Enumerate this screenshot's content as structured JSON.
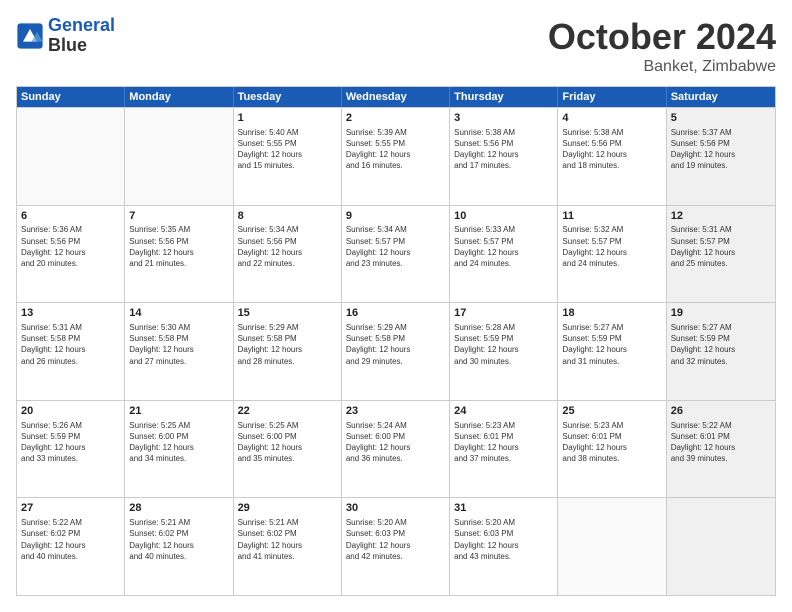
{
  "header": {
    "logo_line1": "General",
    "logo_line2": "Blue",
    "month": "October 2024",
    "location": "Banket, Zimbabwe"
  },
  "weekdays": [
    "Sunday",
    "Monday",
    "Tuesday",
    "Wednesday",
    "Thursday",
    "Friday",
    "Saturday"
  ],
  "rows": [
    [
      {
        "day": "",
        "empty": true
      },
      {
        "day": "",
        "empty": true
      },
      {
        "day": "1",
        "lines": [
          "Sunrise: 5:40 AM",
          "Sunset: 5:55 PM",
          "Daylight: 12 hours",
          "and 15 minutes."
        ]
      },
      {
        "day": "2",
        "lines": [
          "Sunrise: 5:39 AM",
          "Sunset: 5:55 PM",
          "Daylight: 12 hours",
          "and 16 minutes."
        ]
      },
      {
        "day": "3",
        "lines": [
          "Sunrise: 5:38 AM",
          "Sunset: 5:56 PM",
          "Daylight: 12 hours",
          "and 17 minutes."
        ]
      },
      {
        "day": "4",
        "lines": [
          "Sunrise: 5:38 AM",
          "Sunset: 5:56 PM",
          "Daylight: 12 hours",
          "and 18 minutes."
        ]
      },
      {
        "day": "5",
        "lines": [
          "Sunrise: 5:37 AM",
          "Sunset: 5:56 PM",
          "Daylight: 12 hours",
          "and 19 minutes."
        ],
        "shaded": true
      }
    ],
    [
      {
        "day": "6",
        "lines": [
          "Sunrise: 5:36 AM",
          "Sunset: 5:56 PM",
          "Daylight: 12 hours",
          "and 20 minutes."
        ]
      },
      {
        "day": "7",
        "lines": [
          "Sunrise: 5:35 AM",
          "Sunset: 5:56 PM",
          "Daylight: 12 hours",
          "and 21 minutes."
        ]
      },
      {
        "day": "8",
        "lines": [
          "Sunrise: 5:34 AM",
          "Sunset: 5:56 PM",
          "Daylight: 12 hours",
          "and 22 minutes."
        ]
      },
      {
        "day": "9",
        "lines": [
          "Sunrise: 5:34 AM",
          "Sunset: 5:57 PM",
          "Daylight: 12 hours",
          "and 23 minutes."
        ]
      },
      {
        "day": "10",
        "lines": [
          "Sunrise: 5:33 AM",
          "Sunset: 5:57 PM",
          "Daylight: 12 hours",
          "and 24 minutes."
        ]
      },
      {
        "day": "11",
        "lines": [
          "Sunrise: 5:32 AM",
          "Sunset: 5:57 PM",
          "Daylight: 12 hours",
          "and 24 minutes."
        ]
      },
      {
        "day": "12",
        "lines": [
          "Sunrise: 5:31 AM",
          "Sunset: 5:57 PM",
          "Daylight: 12 hours",
          "and 25 minutes."
        ],
        "shaded": true
      }
    ],
    [
      {
        "day": "13",
        "lines": [
          "Sunrise: 5:31 AM",
          "Sunset: 5:58 PM",
          "Daylight: 12 hours",
          "and 26 minutes."
        ]
      },
      {
        "day": "14",
        "lines": [
          "Sunrise: 5:30 AM",
          "Sunset: 5:58 PM",
          "Daylight: 12 hours",
          "and 27 minutes."
        ]
      },
      {
        "day": "15",
        "lines": [
          "Sunrise: 5:29 AM",
          "Sunset: 5:58 PM",
          "Daylight: 12 hours",
          "and 28 minutes."
        ]
      },
      {
        "day": "16",
        "lines": [
          "Sunrise: 5:29 AM",
          "Sunset: 5:58 PM",
          "Daylight: 12 hours",
          "and 29 minutes."
        ]
      },
      {
        "day": "17",
        "lines": [
          "Sunrise: 5:28 AM",
          "Sunset: 5:59 PM",
          "Daylight: 12 hours",
          "and 30 minutes."
        ]
      },
      {
        "day": "18",
        "lines": [
          "Sunrise: 5:27 AM",
          "Sunset: 5:59 PM",
          "Daylight: 12 hours",
          "and 31 minutes."
        ]
      },
      {
        "day": "19",
        "lines": [
          "Sunrise: 5:27 AM",
          "Sunset: 5:59 PM",
          "Daylight: 12 hours",
          "and 32 minutes."
        ],
        "shaded": true
      }
    ],
    [
      {
        "day": "20",
        "lines": [
          "Sunrise: 5:26 AM",
          "Sunset: 5:59 PM",
          "Daylight: 12 hours",
          "and 33 minutes."
        ]
      },
      {
        "day": "21",
        "lines": [
          "Sunrise: 5:25 AM",
          "Sunset: 6:00 PM",
          "Daylight: 12 hours",
          "and 34 minutes."
        ]
      },
      {
        "day": "22",
        "lines": [
          "Sunrise: 5:25 AM",
          "Sunset: 6:00 PM",
          "Daylight: 12 hours",
          "and 35 minutes."
        ]
      },
      {
        "day": "23",
        "lines": [
          "Sunrise: 5:24 AM",
          "Sunset: 6:00 PM",
          "Daylight: 12 hours",
          "and 36 minutes."
        ]
      },
      {
        "day": "24",
        "lines": [
          "Sunrise: 5:23 AM",
          "Sunset: 6:01 PM",
          "Daylight: 12 hours",
          "and 37 minutes."
        ]
      },
      {
        "day": "25",
        "lines": [
          "Sunrise: 5:23 AM",
          "Sunset: 6:01 PM",
          "Daylight: 12 hours",
          "and 38 minutes."
        ]
      },
      {
        "day": "26",
        "lines": [
          "Sunrise: 5:22 AM",
          "Sunset: 6:01 PM",
          "Daylight: 12 hours",
          "and 39 minutes."
        ],
        "shaded": true
      }
    ],
    [
      {
        "day": "27",
        "lines": [
          "Sunrise: 5:22 AM",
          "Sunset: 6:02 PM",
          "Daylight: 12 hours",
          "and 40 minutes."
        ]
      },
      {
        "day": "28",
        "lines": [
          "Sunrise: 5:21 AM",
          "Sunset: 6:02 PM",
          "Daylight: 12 hours",
          "and 40 minutes."
        ]
      },
      {
        "day": "29",
        "lines": [
          "Sunrise: 5:21 AM",
          "Sunset: 6:02 PM",
          "Daylight: 12 hours",
          "and 41 minutes."
        ]
      },
      {
        "day": "30",
        "lines": [
          "Sunrise: 5:20 AM",
          "Sunset: 6:03 PM",
          "Daylight: 12 hours",
          "and 42 minutes."
        ]
      },
      {
        "day": "31",
        "lines": [
          "Sunrise: 5:20 AM",
          "Sunset: 6:03 PM",
          "Daylight: 12 hours",
          "and 43 minutes."
        ]
      },
      {
        "day": "",
        "empty": true
      },
      {
        "day": "",
        "empty": true,
        "shaded": true
      }
    ]
  ]
}
